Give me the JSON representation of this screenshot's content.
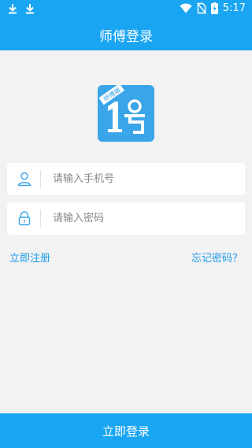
{
  "status_bar": {
    "time": "5:17",
    "left_icons": [
      "download-icon",
      "download-icon"
    ],
    "right_icons": [
      "wifi-icon",
      "no-sim-icon",
      "battery-charging-icon"
    ]
  },
  "header": {
    "title": "师傅登录"
  },
  "logo": {
    "badge_text": "师傅端",
    "glyph": "1号",
    "color": "#3aa5e8"
  },
  "phone_field": {
    "placeholder": "请输入手机号",
    "value": "",
    "icon": "user-icon"
  },
  "password_field": {
    "placeholder": "请输入密码",
    "value": "",
    "icon": "lock-icon"
  },
  "links": {
    "register": "立即注册",
    "forgot_password": "忘记密码？"
  },
  "login_button": {
    "label": "立即登录"
  },
  "colors": {
    "accent": "#1aa5f2",
    "background": "#f2f2f2",
    "link": "#1a9ae8"
  }
}
